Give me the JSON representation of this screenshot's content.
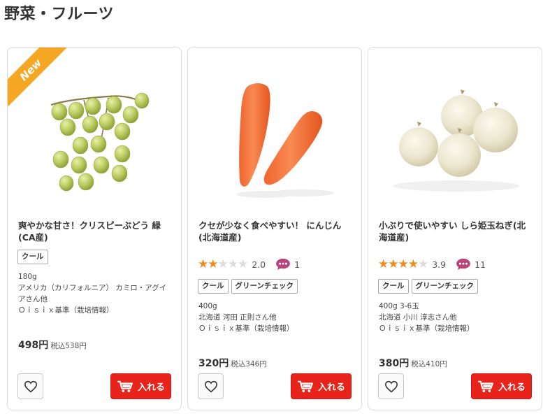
{
  "page": {
    "section_title": "野菜・フルーツ"
  },
  "products": [
    {
      "badge": "New",
      "name": "爽やかな甘さ！クリスピーぶどう 緑(CA産)",
      "rating": null,
      "tags": [
        "クール"
      ],
      "info": [
        "180g",
        "アメリカ（カリフォルニア） カミロ・アグイアさん他",
        "Ｏｉｓｉｘ基準（栽培情報）"
      ],
      "price": "498円",
      "tax_price": "税込538円",
      "fav_icon": "heart-outline-icon",
      "cart_label": "入れる",
      "cart_icon": "cart-icon"
    },
    {
      "badge": "",
      "name": "クセが少なく食べやすい！ にんじん(北海道産)",
      "rating": {
        "value": "2.0",
        "stars_fraction": 0.4,
        "comments": "1"
      },
      "tags": [
        "クール",
        "グリーンチェック"
      ],
      "info": [
        "400g",
        "北海道 河田 正則さん他",
        "Ｏｉｓｉｘ基準（栽培情報）"
      ],
      "price": "320円",
      "tax_price": "税込346円",
      "fav_icon": "heart-outline-icon",
      "cart_label": "入れる",
      "cart_icon": "cart-icon"
    },
    {
      "badge": "",
      "name": "小ぶりで使いやすい しら姫玉ねぎ(北海道産)",
      "rating": {
        "value": "3.9",
        "stars_fraction": 0.78,
        "comments": "11"
      },
      "tags": [
        "クール",
        "グリーンチェック"
      ],
      "info": [
        "400g 3-6玉",
        "北海道 小川 淳志さん他",
        "Ｏｉｓｉｘ基準（栽培情報）"
      ],
      "price": "380円",
      "tax_price": "税込410円",
      "fav_icon": "heart-outline-icon",
      "cart_label": "入れる",
      "cart_icon": "cart-icon"
    }
  ],
  "colors": {
    "accent_red": "#e8231b",
    "badge_orange": "#f5a623",
    "star_orange": "#f08c1c",
    "comment_purple": "#b5457a"
  }
}
